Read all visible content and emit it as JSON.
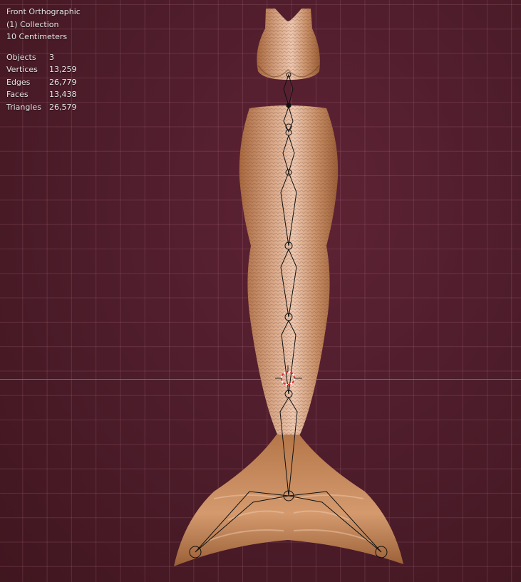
{
  "viewport": {
    "view_name": "Front Orthographic",
    "collection": "(1) Collection",
    "scale": "10 Centimeters"
  },
  "stats": [
    {
      "label": "Objects",
      "value": "3"
    },
    {
      "label": "Vertices",
      "value": "13,259"
    },
    {
      "label": "Edges",
      "value": "26,779"
    },
    {
      "label": "Faces",
      "value": "13,438"
    },
    {
      "label": "Triangles",
      "value": "26,579"
    }
  ],
  "colors": {
    "background": "#4f1d2c",
    "grid": "#be788c",
    "x_axis": "#d0485c",
    "model": "#c08a62"
  }
}
